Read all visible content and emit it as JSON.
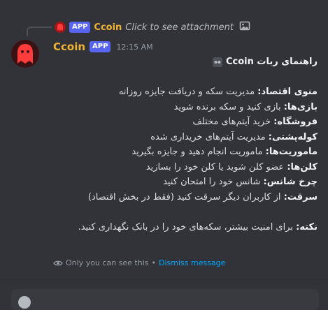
{
  "reply": {
    "badge": "APP",
    "username": "Ccoin",
    "text": "Click to see attachment",
    "attachment_icon": "image-icon"
  },
  "message": {
    "username": "Ccoin",
    "badge": "APP",
    "timestamp": "12:15 AM",
    "title": "راهنمای ربات Ccoin",
    "title_icon": "robot-icon",
    "lines": [
      {
        "label": "منوی اقتصاد:",
        "text": " مدیریت سکه و دریافت جایزه روزانه"
      },
      {
        "label": "بازی‌ها:",
        "text": " بازی کنید و سکه برنده شوید"
      },
      {
        "label": "فروشگاه:",
        "text": " خرید آیتم‌های مختلف"
      },
      {
        "label": "کوله‌پشتی:",
        "text": " مدیریت آیتم‌های خریداری شده"
      },
      {
        "label": "ماموریت‌ها:",
        "text": " ماموریت انجام دهید و جایزه بگیرید"
      },
      {
        "label": "کلن‌ها:",
        "text": " عضو کلن شوید یا کلن خود را بسازید"
      },
      {
        "label": "چرخ شانس:",
        "text": " شانس خود را امتحان کنید"
      },
      {
        "label": "سرقت:",
        "text": " از کاربران دیگر سرقت کنید (فقط در بخش اقتصاد)"
      }
    ],
    "note_label": "نکته:",
    "note_text": " برای امنیت بیشتر، سکه‌های خود را در بانک نگهداری کنید."
  },
  "ephemeral": {
    "text": "Only you can see this",
    "separator": "•",
    "dismiss": "Dismiss message"
  },
  "colors": {
    "background": "#313338",
    "username": "#f0b232",
    "badge": "#5865f2",
    "link": "#00a8fc"
  }
}
